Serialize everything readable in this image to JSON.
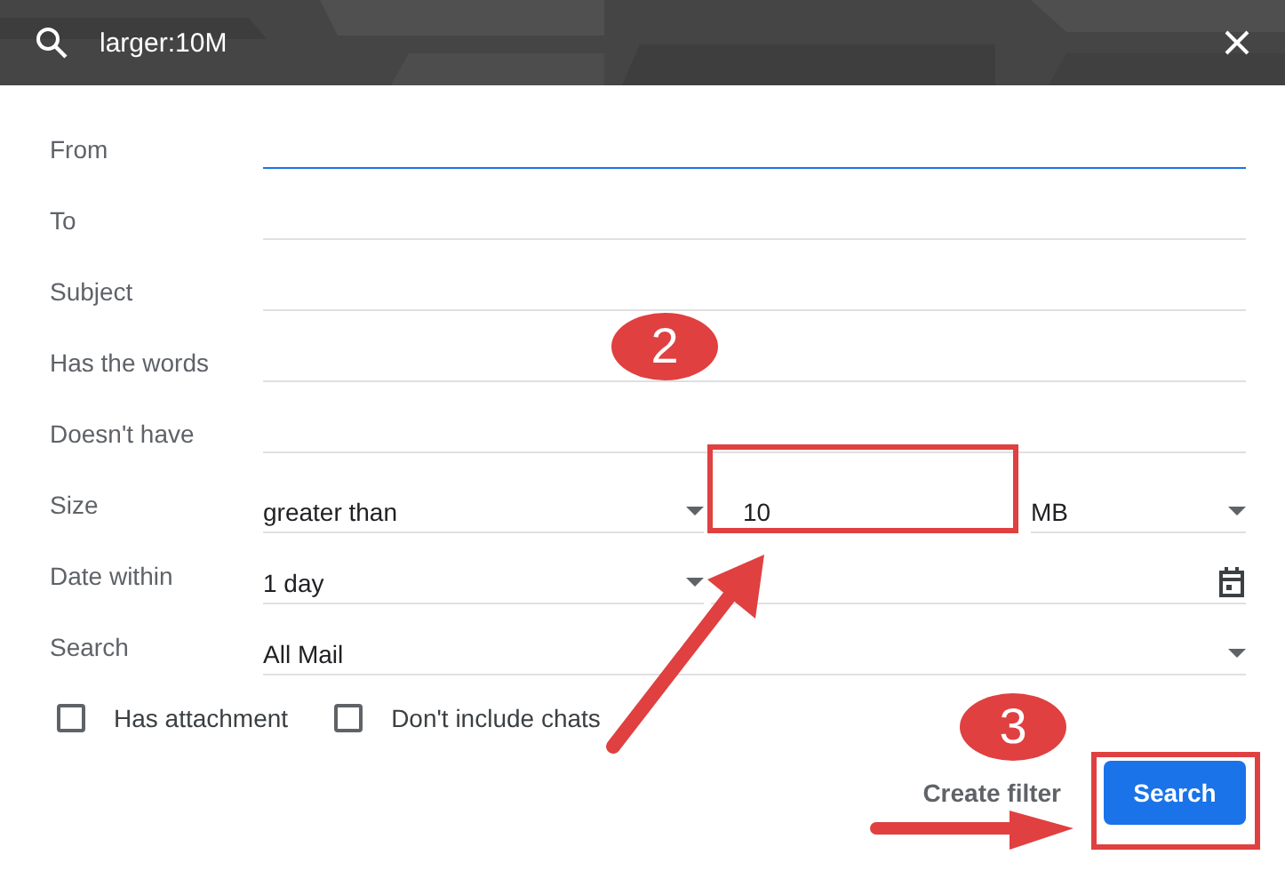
{
  "search_bar": {
    "query": "larger:10M"
  },
  "fields": [
    {
      "kind": "text",
      "label": "From",
      "focused": true
    },
    {
      "kind": "text",
      "label": "To",
      "focused": false
    },
    {
      "kind": "text",
      "label": "Subject",
      "focused": false
    },
    {
      "kind": "text",
      "label": "Has the words",
      "focused": false
    },
    {
      "kind": "text",
      "label": "Doesn't have",
      "focused": false
    },
    {
      "kind": "size",
      "label": "Size",
      "operator": "greater than",
      "value": "10",
      "unit": "MB"
    },
    {
      "kind": "date",
      "label": "Date within",
      "range": "1 day"
    },
    {
      "kind": "select",
      "label": "Search",
      "value": "All Mail"
    }
  ],
  "checkboxes": [
    {
      "label": "Has attachment",
      "checked": false
    },
    {
      "label": "Don't include chats",
      "checked": false
    }
  ],
  "buttons": {
    "create_filter": "Create filter",
    "search": "Search"
  },
  "step_badges": [
    {
      "number": "2"
    },
    {
      "number": "3"
    }
  ]
}
